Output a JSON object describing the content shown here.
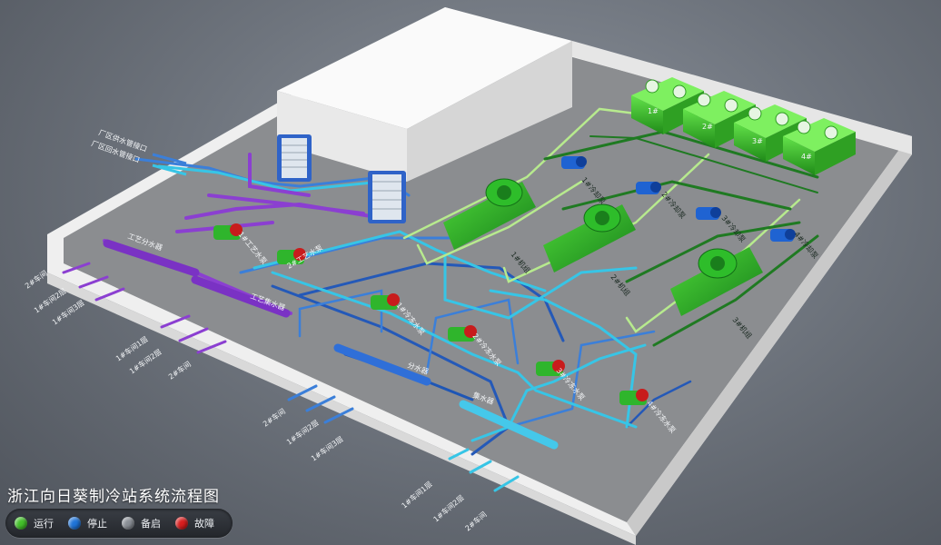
{
  "title": "浙江向日葵制冷站系统流程图",
  "legend": {
    "running": {
      "label": "运行",
      "color": "#43c02a"
    },
    "stopped": {
      "label": "停止",
      "color": "#1f74d8"
    },
    "standby": {
      "label": "备启",
      "color": "#8a8f96"
    },
    "fault": {
      "label": "故障",
      "color": "#d81e1e"
    }
  },
  "cooling_towers": [
    "1#",
    "2#",
    "3#",
    "4#"
  ],
  "chillers": [
    "1#机组",
    "2#机组",
    "3#机组"
  ],
  "cooling_pumps": [
    "1#冷却泵",
    "2#冷却泵",
    "3#冷却泵",
    "4#冷却泵"
  ],
  "chilled_pumps": [
    "1#冷冻水泵",
    "2#冷冻水泵",
    "3#冷冻水泵",
    "4#冷冻水泵"
  ],
  "process_pumps": [
    "1#工艺水泵",
    "2#工艺水泵"
  ],
  "headers": {
    "supply": "分水器",
    "return": "集水器",
    "process_supply": "工艺分水器",
    "process_return": "工艺集水器"
  },
  "plant_lines": [
    "厂区供水管接口",
    "厂区回水管接口"
  ],
  "outlets": {
    "purple_upper": [
      "2#车间",
      "1#车间2层",
      "1#车间3层"
    ],
    "purple_lower": [
      "1#车间1层",
      "1#车间2层",
      "2#车间"
    ],
    "blue_mid": [
      "2#车间",
      "1#车间2层",
      "1#车间3层"
    ],
    "blue_lower": [
      "1#车间1层",
      "1#车间2层",
      "2#车间"
    ]
  }
}
